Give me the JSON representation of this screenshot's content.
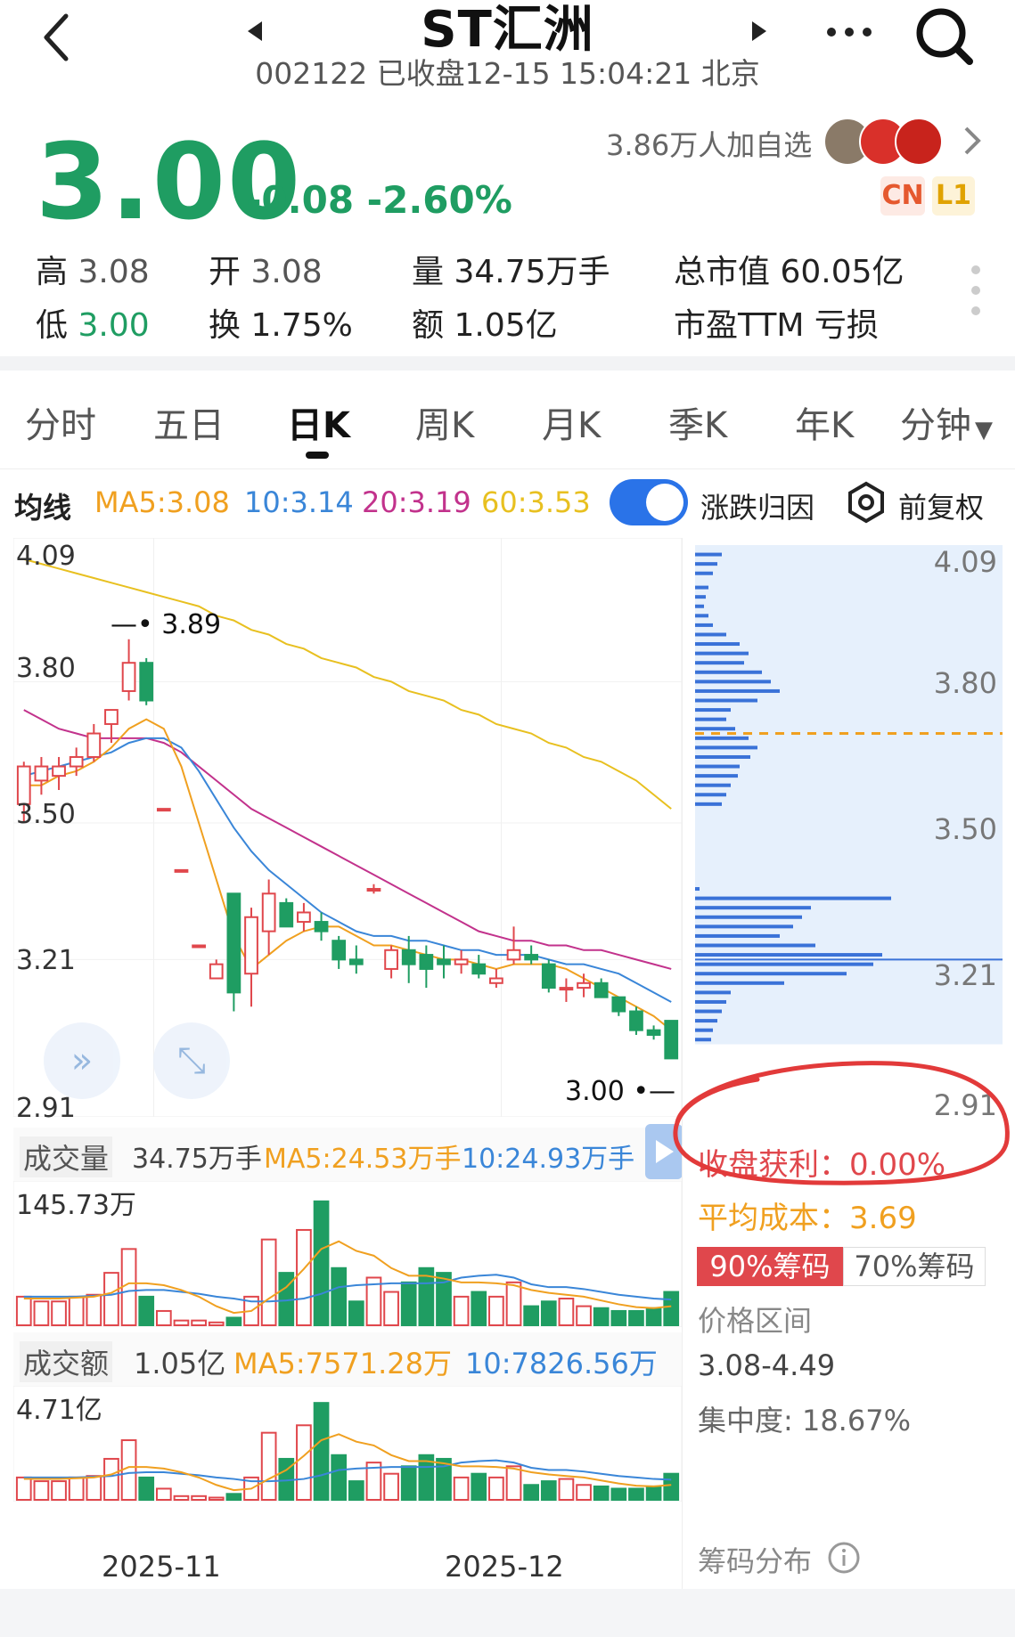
{
  "header": {
    "title": "ST汇洲",
    "subtitle": "002122 已收盘12-15 15:04:21 北京"
  },
  "quote": {
    "price": "3.00",
    "change": "-0.08 -2.60%",
    "followers": "3.86万人加自选",
    "badge_cn": "CN",
    "badge_l1": "L1"
  },
  "stats": {
    "high_label": "高",
    "high": "3.08",
    "open_label": "开",
    "open": "3.08",
    "vol_label": "量",
    "vol": "34.75万手",
    "mktcap_label": "总市值",
    "mktcap": "60.05亿",
    "low_label": "低",
    "low": "3.00",
    "turnover_label": "换",
    "turnover": "1.75%",
    "amount_label": "额",
    "amount": "1.05亿",
    "pe_label": "市盈TTM",
    "pe": "亏损"
  },
  "tabs": [
    "分时",
    "五日",
    "日K",
    "周K",
    "月K",
    "季K",
    "年K",
    "分钟"
  ],
  "ma": {
    "label": "均线",
    "ma5": "MA5:3.08",
    "ma10": "10:3.14",
    "ma20": "20:3.19",
    "ma60": "60:3.53",
    "toggle_label": "涨跌归因",
    "adjust_label": "前复权"
  },
  "chart": {
    "y_ticks": [
      "4.09",
      "3.80",
      "3.50",
      "3.21",
      "2.91"
    ],
    "high_marker": "3.89",
    "low_marker": "3.00"
  },
  "volume": {
    "label": "成交量",
    "value": "34.75万手",
    "ma5": "MA5:24.53万手",
    "ma10": "10:24.93万手",
    "max": "145.73万"
  },
  "amount_panel": {
    "label": "成交额",
    "value": "1.05亿",
    "ma5": "MA5:7571.28万",
    "ma10": "10:7826.56万",
    "max": "4.71亿"
  },
  "x_labels": [
    "2025-11",
    "2025-12"
  ],
  "chips": {
    "profit_label": "收盘获利：",
    "profit": "0.00%",
    "cost_label": "平均成本：",
    "cost": "3.69",
    "tab90": "90%筹码",
    "tab70": "70%筹码",
    "range_label": "价格区间",
    "range": "3.08-4.49",
    "concentration": "集中度: 18.67%",
    "footer": "筹码分布",
    "y_ticks": [
      "4.09",
      "3.80",
      "3.50",
      "3.21",
      "2.91"
    ]
  },
  "colors": {
    "up": "#e0474c",
    "down": "#1f9d62",
    "ma5": "#f0a020",
    "ma10": "#3a86d8",
    "ma20": "#c2328c",
    "ma60": "#e8c020"
  },
  "chart_data": {
    "type": "candlestick",
    "ylim": [
      2.91,
      4.09
    ],
    "candles": [
      {
        "o": 3.54,
        "h": 3.63,
        "l": 3.5,
        "c": 3.62
      },
      {
        "o": 3.59,
        "h": 3.64,
        "l": 3.56,
        "c": 3.62
      },
      {
        "o": 3.6,
        "h": 3.64,
        "l": 3.57,
        "c": 3.62
      },
      {
        "o": 3.62,
        "h": 3.66,
        "l": 3.6,
        "c": 3.64
      },
      {
        "o": 3.64,
        "h": 3.71,
        "l": 3.63,
        "c": 3.69
      },
      {
        "o": 3.71,
        "h": 3.74,
        "l": 3.67,
        "c": 3.74
      },
      {
        "o": 3.78,
        "h": 3.89,
        "l": 3.76,
        "c": 3.84
      },
      {
        "o": 3.84,
        "h": 3.85,
        "l": 3.75,
        "c": 3.76
      },
      {
        "o": 3.53,
        "h": 3.53,
        "l": 3.53,
        "c": 3.53
      },
      {
        "o": 3.4,
        "h": 3.4,
        "l": 3.4,
        "c": 3.4
      },
      {
        "o": 3.24,
        "h": 3.24,
        "l": 3.24,
        "c": 3.24
      },
      {
        "o": 3.17,
        "h": 3.21,
        "l": 3.17,
        "c": 3.2
      },
      {
        "o": 3.35,
        "h": 3.35,
        "l": 3.1,
        "c": 3.14
      },
      {
        "o": 3.18,
        "h": 3.32,
        "l": 3.11,
        "c": 3.3
      },
      {
        "o": 3.27,
        "h": 3.38,
        "l": 3.22,
        "c": 3.35
      },
      {
        "o": 3.33,
        "h": 3.34,
        "l": 3.28,
        "c": 3.28
      },
      {
        "o": 3.29,
        "h": 3.33,
        "l": 3.27,
        "c": 3.31
      },
      {
        "o": 3.29,
        "h": 3.31,
        "l": 3.25,
        "c": 3.27
      },
      {
        "o": 3.25,
        "h": 3.26,
        "l": 3.19,
        "c": 3.21
      },
      {
        "o": 3.21,
        "h": 3.24,
        "l": 3.18,
        "c": 3.2
      },
      {
        "o": 3.36,
        "h": 3.37,
        "l": 3.35,
        "c": 3.36
      },
      {
        "o": 3.19,
        "h": 3.24,
        "l": 3.17,
        "c": 3.23
      },
      {
        "o": 3.23,
        "h": 3.26,
        "l": 3.16,
        "c": 3.2
      },
      {
        "o": 3.22,
        "h": 3.24,
        "l": 3.15,
        "c": 3.19
      },
      {
        "o": 3.21,
        "h": 3.24,
        "l": 3.17,
        "c": 3.2
      },
      {
        "o": 3.2,
        "h": 3.23,
        "l": 3.18,
        "c": 3.21
      },
      {
        "o": 3.2,
        "h": 3.22,
        "l": 3.17,
        "c": 3.18
      },
      {
        "o": 3.16,
        "h": 3.19,
        "l": 3.15,
        "c": 3.17
      },
      {
        "o": 3.21,
        "h": 3.28,
        "l": 3.2,
        "c": 3.23
      },
      {
        "o": 3.22,
        "h": 3.24,
        "l": 3.2,
        "c": 3.21
      },
      {
        "o": 3.2,
        "h": 3.21,
        "l": 3.14,
        "c": 3.15
      },
      {
        "o": 3.15,
        "h": 3.17,
        "l": 3.12,
        "c": 3.15
      },
      {
        "o": 3.15,
        "h": 3.18,
        "l": 3.13,
        "c": 3.16
      },
      {
        "o": 3.16,
        "h": 3.17,
        "l": 3.13,
        "c": 3.13
      },
      {
        "o": 3.13,
        "h": 3.13,
        "l": 3.09,
        "c": 3.1
      },
      {
        "o": 3.1,
        "h": 3.11,
        "l": 3.05,
        "c": 3.06
      },
      {
        "o": 3.06,
        "h": 3.07,
        "l": 3.04,
        "c": 3.05
      },
      {
        "o": 3.08,
        "h": 3.08,
        "l": 3.0,
        "c": 3.0
      }
    ],
    "ma5": [
      3.58,
      3.58,
      3.6,
      3.61,
      3.63,
      3.66,
      3.7,
      3.72,
      3.7,
      3.62,
      3.5,
      3.38,
      3.26,
      3.19,
      3.22,
      3.25,
      3.27,
      3.28,
      3.28,
      3.26,
      3.24,
      3.24,
      3.23,
      3.22,
      3.21,
      3.21,
      3.2,
      3.19,
      3.2,
      3.2,
      3.2,
      3.19,
      3.17,
      3.15,
      3.13,
      3.11,
      3.09,
      3.06
    ],
    "ma10": [
      3.6,
      3.61,
      3.62,
      3.63,
      3.64,
      3.65,
      3.67,
      3.68,
      3.68,
      3.66,
      3.61,
      3.55,
      3.49,
      3.44,
      3.4,
      3.37,
      3.34,
      3.31,
      3.29,
      3.27,
      3.26,
      3.26,
      3.25,
      3.25,
      3.24,
      3.23,
      3.23,
      3.22,
      3.22,
      3.22,
      3.21,
      3.2,
      3.2,
      3.19,
      3.18,
      3.16,
      3.14,
      3.12
    ],
    "ma20": [
      3.74,
      3.72,
      3.7,
      3.69,
      3.68,
      3.68,
      3.68,
      3.68,
      3.67,
      3.65,
      3.62,
      3.59,
      3.56,
      3.53,
      3.51,
      3.49,
      3.47,
      3.45,
      3.43,
      3.41,
      3.39,
      3.37,
      3.35,
      3.33,
      3.31,
      3.29,
      3.27,
      3.26,
      3.25,
      3.25,
      3.24,
      3.24,
      3.23,
      3.23,
      3.22,
      3.21,
      3.2,
      3.19
    ],
    "ma60": [
      4.06,
      4.05,
      4.04,
      4.03,
      4.02,
      4.01,
      4.0,
      3.99,
      3.98,
      3.97,
      3.96,
      3.94,
      3.93,
      3.91,
      3.9,
      3.88,
      3.87,
      3.85,
      3.84,
      3.83,
      3.81,
      3.8,
      3.78,
      3.77,
      3.76,
      3.74,
      3.73,
      3.71,
      3.7,
      3.69,
      3.67,
      3.66,
      3.64,
      3.63,
      3.61,
      3.59,
      3.56,
      3.53
    ],
    "volume": [
      30,
      25,
      25,
      30,
      32,
      55,
      80,
      30,
      15,
      5,
      5,
      3,
      8,
      30,
      90,
      55,
      100,
      130,
      60,
      25,
      50,
      35,
      45,
      60,
      55,
      30,
      35,
      30,
      45,
      20,
      25,
      28,
      20,
      18,
      15,
      15,
      18,
      35
    ],
    "volume_max": 145.73,
    "volume_ma5": [
      28,
      28,
      28,
      29,
      30,
      34,
      44,
      44,
      42,
      37,
      30,
      20,
      13,
      15,
      28,
      40,
      59,
      80,
      88,
      78,
      73,
      60,
      52,
      52,
      49,
      45,
      45,
      44,
      42,
      37,
      34,
      32,
      30,
      26,
      22,
      19,
      18,
      20
    ],
    "volume_ma10": [
      30,
      30,
      30,
      30,
      31,
      32,
      36,
      37,
      37,
      35,
      33,
      30,
      28,
      25,
      25,
      26,
      28,
      33,
      40,
      42,
      43,
      44,
      44,
      44,
      45,
      50,
      52,
      53,
      50,
      43,
      40,
      40,
      38,
      35,
      32,
      30,
      28,
      27
    ],
    "chip_bars": [
      {
        "p": 4.07,
        "w": 30
      },
      {
        "p": 4.05,
        "w": 25
      },
      {
        "p": 4.03,
        "w": 20
      },
      {
        "p": 4.0,
        "w": 15
      },
      {
        "p": 3.98,
        "w": 12
      },
      {
        "p": 3.96,
        "w": 10
      },
      {
        "p": 3.94,
        "w": 15
      },
      {
        "p": 3.92,
        "w": 20
      },
      {
        "p": 3.9,
        "w": 35
      },
      {
        "p": 3.88,
        "w": 50
      },
      {
        "p": 3.86,
        "w": 60
      },
      {
        "p": 3.84,
        "w": 55
      },
      {
        "p": 3.82,
        "w": 75
      },
      {
        "p": 3.8,
        "w": 85
      },
      {
        "p": 3.78,
        "w": 95
      },
      {
        "p": 3.76,
        "w": 70
      },
      {
        "p": 3.74,
        "w": 40
      },
      {
        "p": 3.72,
        "w": 35
      },
      {
        "p": 3.7,
        "w": 45
      },
      {
        "p": 3.68,
        "w": 60
      },
      {
        "p": 3.66,
        "w": 70
      },
      {
        "p": 3.64,
        "w": 62
      },
      {
        "p": 3.62,
        "w": 50
      },
      {
        "p": 3.6,
        "w": 48
      },
      {
        "p": 3.58,
        "w": 40
      },
      {
        "p": 3.56,
        "w": 35
      },
      {
        "p": 3.54,
        "w": 30
      },
      {
        "p": 3.36,
        "w": 5
      },
      {
        "p": 3.34,
        "w": 220
      },
      {
        "p": 3.32,
        "w": 130
      },
      {
        "p": 3.3,
        "w": 120
      },
      {
        "p": 3.28,
        "w": 110
      },
      {
        "p": 3.26,
        "w": 95
      },
      {
        "p": 3.24,
        "w": 135
      },
      {
        "p": 3.22,
        "w": 210
      },
      {
        "p": 3.2,
        "w": 200
      },
      {
        "p": 3.18,
        "w": 170
      },
      {
        "p": 3.16,
        "w": 100
      },
      {
        "p": 3.14,
        "w": 40
      },
      {
        "p": 3.12,
        "w": 35
      },
      {
        "p": 3.1,
        "w": 30
      },
      {
        "p": 3.08,
        "w": 25
      },
      {
        "p": 3.06,
        "w": 20
      },
      {
        "p": 3.04,
        "w": 18
      },
      {
        "p": 3.02,
        "w": 16
      },
      {
        "p": 3.0,
        "w": 14
      }
    ],
    "avg_cost": 3.69,
    "close": 3.21
  }
}
